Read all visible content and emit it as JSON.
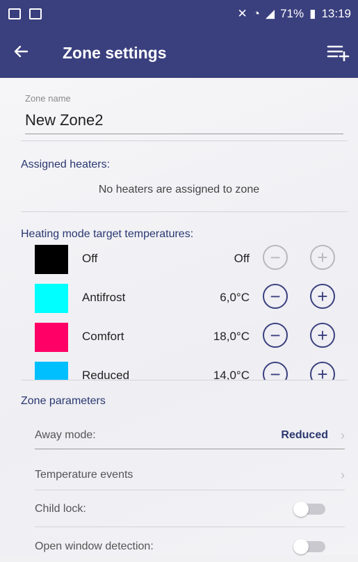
{
  "status_bar": {
    "battery": "71%",
    "time": "13:19"
  },
  "app_bar": {
    "title": "Zone settings",
    "back_icon": "arrow-left-icon",
    "menu_icon": "add-list-icon"
  },
  "zone_name": {
    "label": "Zone name",
    "value": "New Zone2"
  },
  "assigned_heaters": {
    "title": "Assigned heaters:",
    "empty_message": "No heaters are assigned to zone"
  },
  "heating_modes": {
    "title": "Heating mode target temperatures:",
    "items": [
      {
        "name": "Off",
        "value": "Off",
        "color": "#000000",
        "enabled": false
      },
      {
        "name": "Antifrost",
        "value": "6,0°C",
        "color": "#00ffff",
        "enabled": true
      },
      {
        "name": "Comfort",
        "value": "18,0°C",
        "color": "#ff0066",
        "enabled": true
      },
      {
        "name": "Reduced",
        "value": "14,0°C",
        "color": "#00bfff",
        "enabled": true
      }
    ]
  },
  "zone_parameters": {
    "title": "Zone parameters",
    "away_mode": {
      "label": "Away mode:",
      "value": "Reduced"
    },
    "temperature_events": {
      "label": "Temperature events"
    },
    "child_lock": {
      "label": "Child lock:",
      "on": false
    },
    "open_window_detection": {
      "label": "Open window detection:",
      "on": false
    }
  },
  "colors": {
    "primary": "#3a3f7e",
    "accent_text": "#2a3770",
    "background": "#f1f1f4"
  }
}
